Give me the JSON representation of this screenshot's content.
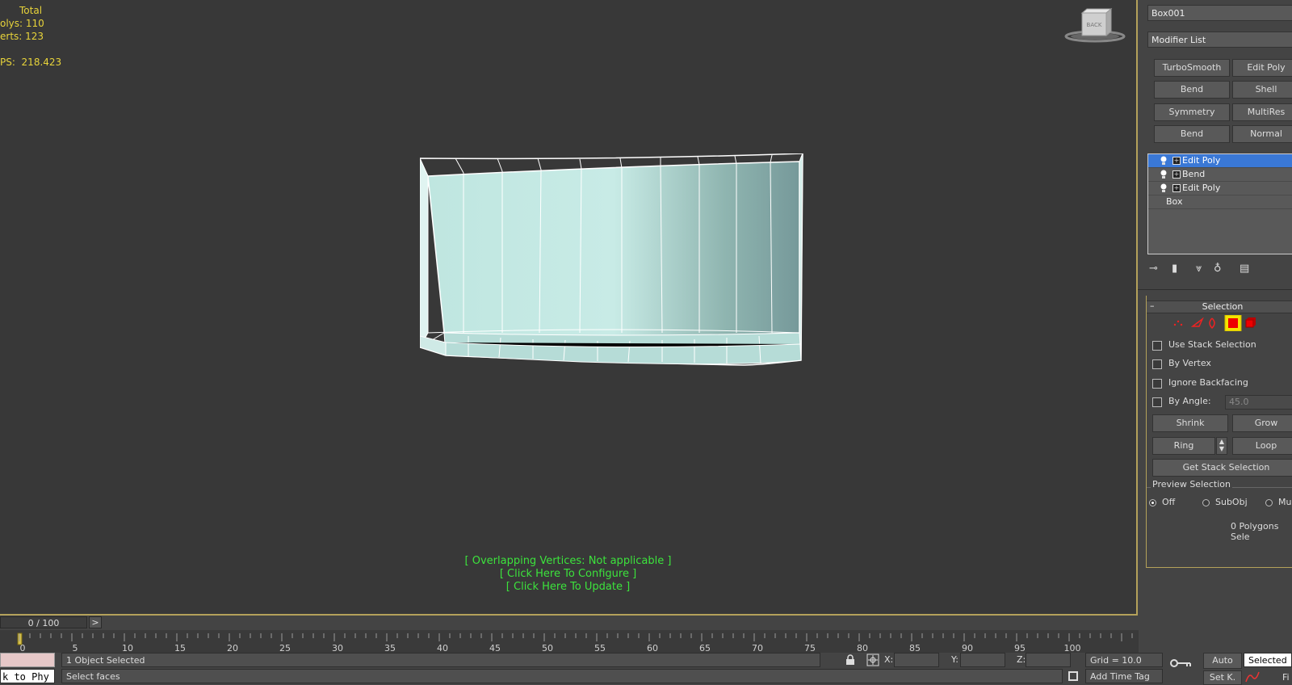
{
  "viewport": {
    "stats_title": "Total",
    "polys_label": "olys:",
    "polys_value": "110",
    "verts_label": "erts:",
    "verts_value": "123",
    "fps_label": "PS:",
    "fps_value": "218.423",
    "viewcube_label": "BACK",
    "overlay_line1": "[ Overlapping Vertices: Not applicable ]",
    "overlay_line2": "[ Click Here To Configure ]",
    "overlay_line3": "[ Click Here To Update ]"
  },
  "panel": {
    "object_name": "Box001",
    "modifier_list": "Modifier List",
    "buttons": [
      "TurboSmooth",
      "Edit Poly",
      "Bend",
      "Shell",
      "Symmetry",
      "MultiRes",
      "Bend",
      "Normal"
    ],
    "stack": [
      {
        "label": "Edit Poly",
        "selected": true
      },
      {
        "label": "Bend",
        "selected": false
      },
      {
        "label": "Edit Poly",
        "selected": false
      }
    ],
    "stack_base": "Box",
    "selection_title": "Selection",
    "rollout_toggle": "–",
    "use_stack_selection": "Use Stack Selection",
    "by_vertex": "By Vertex",
    "ignore_backfacing": "Ignore Backfacing",
    "by_angle": "By Angle:",
    "angle_value": "45.0",
    "shrink": "Shrink",
    "grow": "Grow",
    "ring": "Ring",
    "loop": "Loop",
    "get_stack_selection": "Get Stack Selection",
    "preview_selection": "Preview Selection",
    "preview_off": "Off",
    "preview_subobj": "SubObj",
    "preview_multi": "Mul",
    "polygons_selected": "0 Polygons Sele"
  },
  "timeline": {
    "frame_display": "0 / 100",
    "next_symbol": ">",
    "ticks": [
      "0",
      "5",
      "10",
      "15",
      "20",
      "25",
      "30",
      "35",
      "40",
      "45",
      "50",
      "55",
      "60",
      "65",
      "70",
      "75",
      "80",
      "85",
      "90",
      "95",
      "100"
    ]
  },
  "status": {
    "script_text": "k to Phy",
    "selection_info": "1 Object Selected",
    "prompt": "Select faces",
    "x_label": "X:",
    "y_label": "Y:",
    "z_label": "Z:",
    "grid": "Grid = 10.0",
    "add_time_tag": "Add Time Tag",
    "auto": "Auto",
    "set_key": "Set K.",
    "selected_dropdown": "Selected",
    "filters": "Fi"
  }
}
